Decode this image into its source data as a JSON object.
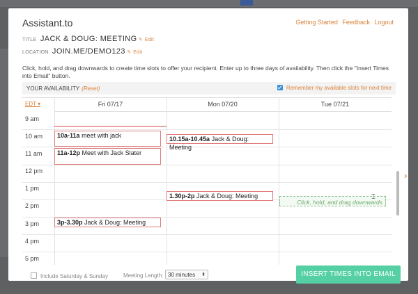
{
  "app": {
    "title": "Assistant.to"
  },
  "top_links": [
    "Getting Started",
    "Feedback",
    "Logout"
  ],
  "meeting": {
    "title_label": "TITLE",
    "title_value": "JACK & DOUG: MEETING",
    "location_label": "LOCATION",
    "location_value": "JOIN.ME/DEMO123",
    "edit_label": "Edit"
  },
  "instructions": "Click, hold, and drag downwards to create time slots to offer your recipient. Enter up to three days of availability. Then click the \"Insert Times into Email\" button.",
  "availability": {
    "label": "YOUR AVAILABILITY",
    "reset": "(Reset)",
    "remember": "Remember my available slots for next time",
    "remember_checked": true
  },
  "calendar": {
    "timezone": "EDT",
    "days": [
      "Fri 07/17",
      "Mon 07/20",
      "Tue 07/21"
    ],
    "hours": [
      "9 am",
      "10 am",
      "11 am",
      "12 pm",
      "1 pm",
      "2 pm",
      "3 pm",
      "4 pm",
      "5 pm"
    ],
    "events": [
      {
        "time": "10a-11a",
        "title": "meet with jack"
      },
      {
        "time": "11a-12p",
        "title": "Meet with Jack Slater"
      },
      {
        "time": "3p-3.30p",
        "title": "Jack & Doug: Meeting"
      },
      {
        "time": "10.15a-10.45a",
        "title": "Jack & Doug: Meeting"
      },
      {
        "time": "1.30p-2p",
        "title": "Jack & Doug: Meeting"
      }
    ],
    "drag_hint": "Click, hold, and drag downwards"
  },
  "footer": {
    "weekend_label": "Include Saturday & Sunday",
    "meeting_length_label": "Meeting Length:",
    "meeting_length_value": "30 minutes",
    "insert_button": "INSERT TIMES INTO EMAIL"
  },
  "colors": {
    "accent": "#d9823b",
    "button": "#55d0a4",
    "event_border": "#e07b7b",
    "now_line": "#d94444"
  }
}
